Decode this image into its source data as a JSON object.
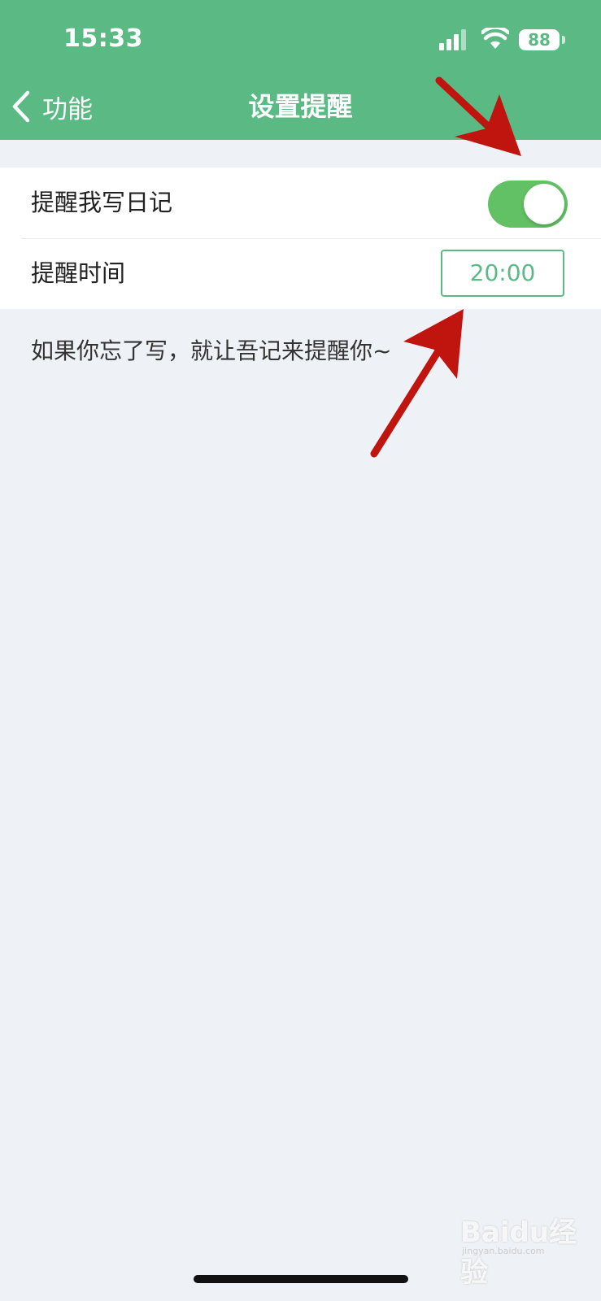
{
  "status_bar": {
    "time": "15:33",
    "battery": "88",
    "icons": [
      "signal-icon",
      "wifi-icon",
      "battery-icon"
    ]
  },
  "nav": {
    "back_label": "功能",
    "title": "设置提醒",
    "back_icon": "chevron-left-icon"
  },
  "settings": {
    "reminder_toggle_label": "提醒我写日记",
    "reminder_enabled": true,
    "reminder_time_label": "提醒时间",
    "reminder_time": "20:00"
  },
  "hint_text": "如果你忘了写，就让吾记来提醒你~",
  "watermark": {
    "brand": "Baidu经验",
    "url": "jingyan.baidu.com"
  },
  "colors": {
    "header": "#5bba84",
    "toggle_on": "#62c165",
    "background": "#eef1f5",
    "annotation_arrow": "#c0150f"
  }
}
